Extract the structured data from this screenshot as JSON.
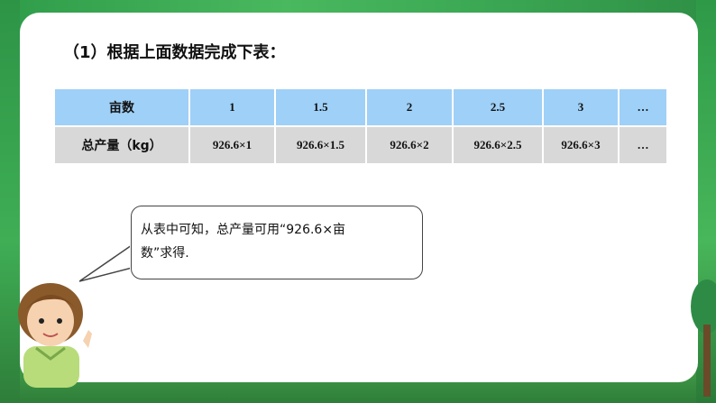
{
  "title": "（1）根据上面数据完成下表：",
  "table": {
    "row1": [
      "亩数",
      "1",
      "1.5",
      "2",
      "2.5",
      "3",
      "…"
    ],
    "row2": [
      "总产量（kg）",
      "926.6×1",
      "926.6×1.5",
      "926.6×2",
      "926.6×2.5",
      "926.6×3",
      "…"
    ]
  },
  "bubble": {
    "line1": "从表中可知，总产量可用“926.6×亩",
    "line2": "数”求得."
  },
  "colors": {
    "header_row": "#9fd0f7",
    "data_row": "#d8d8d8",
    "answer_text": "#1b22c8",
    "frame_green": "#3fae55"
  }
}
